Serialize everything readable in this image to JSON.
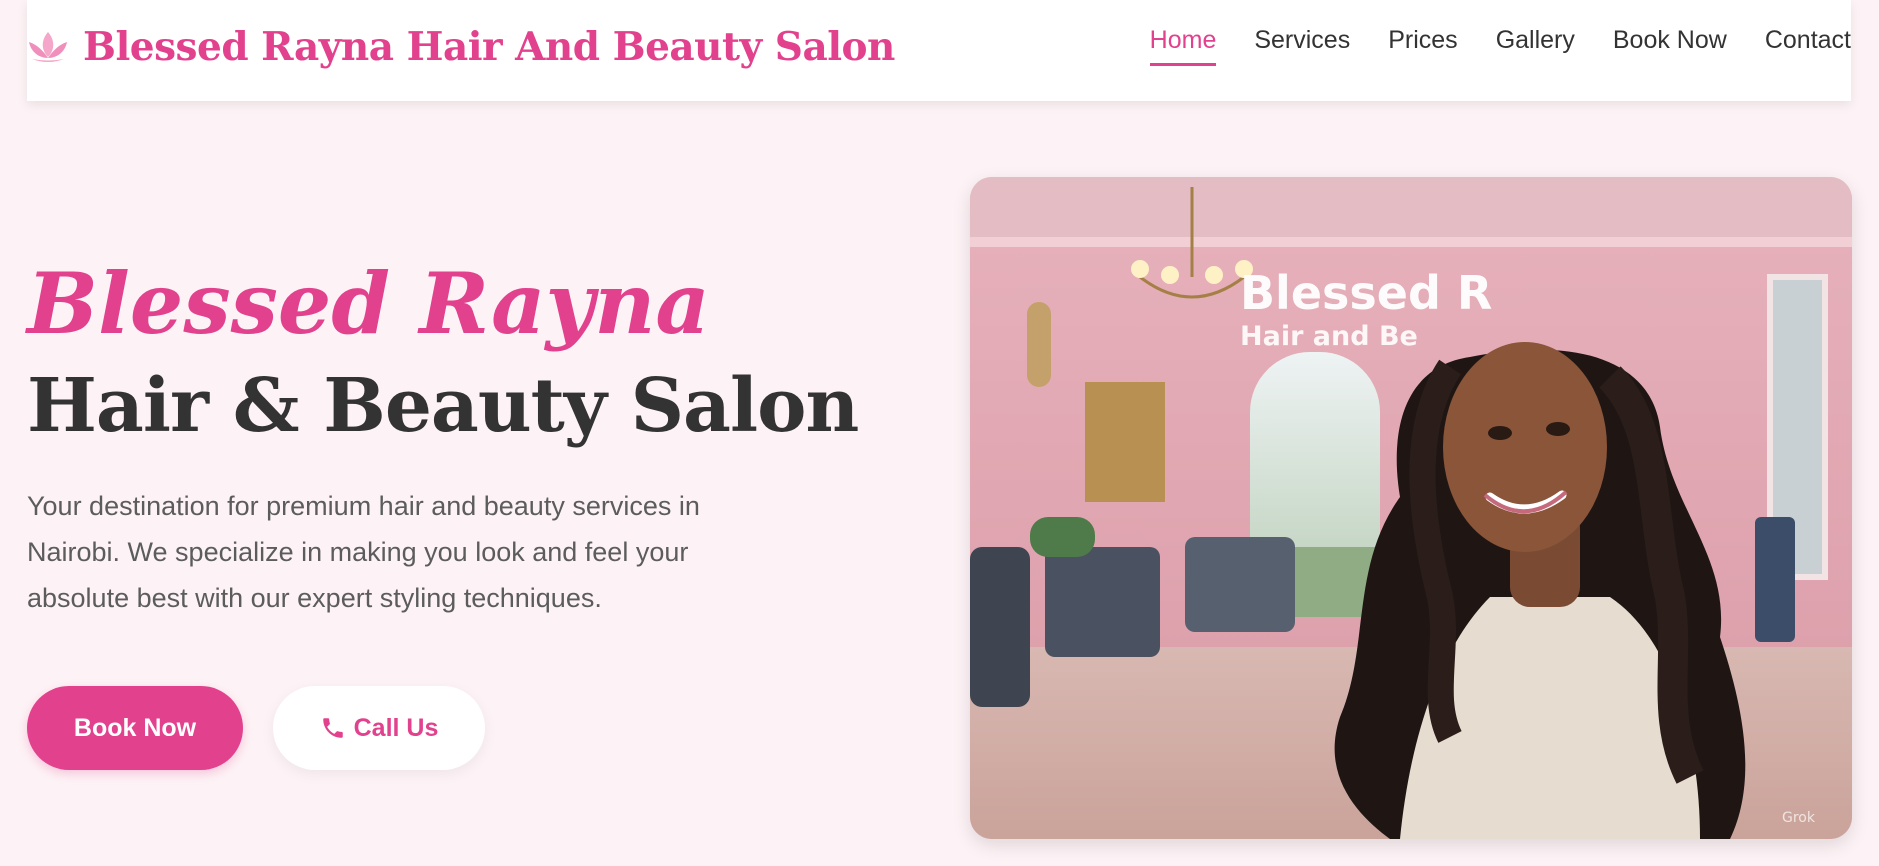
{
  "header": {
    "brand_name": "Blessed Rayna Hair And Beauty Salon",
    "logo_icon": "lotus-icon",
    "nav": [
      {
        "label": "Home",
        "active": true
      },
      {
        "label": "Services"
      },
      {
        "label": "Prices"
      },
      {
        "label": "Gallery"
      },
      {
        "label": "Book Now"
      },
      {
        "label": "Contact"
      }
    ]
  },
  "hero": {
    "script_title": "Blessed Rayna",
    "title": "Hair & Beauty Salon",
    "description": "Your destination for premium hair and beauty services in Nairobi. We specialize in making you look and feel your absolute best with our expert styling techniques.",
    "primary_button": "Book Now",
    "secondary_button": "Call Us",
    "secondary_icon": "phone-icon",
    "image": {
      "sign_line1": "Blessed R",
      "sign_line2": "Hair and Be",
      "watermark": "Grok"
    }
  },
  "colors": {
    "accent": "#e2418d",
    "background": "#fdf3f6",
    "text_dark": "#333333",
    "text_body": "#5c5c5c"
  }
}
